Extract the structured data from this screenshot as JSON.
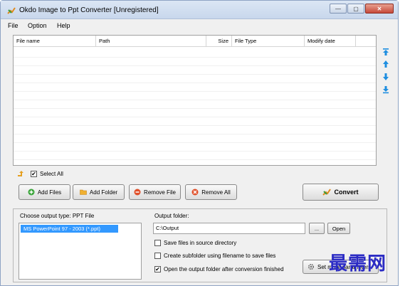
{
  "window": {
    "title": "Okdo Image to Ppt Converter [Unregistered]",
    "controls": {
      "minimize": "—",
      "maximize": "▢",
      "close": "✕"
    }
  },
  "menu": {
    "items": [
      "File",
      "Option",
      "Help"
    ]
  },
  "file_list": {
    "columns": [
      "File name",
      "Path",
      "Size",
      "File Type",
      "Modify date"
    ],
    "rows": []
  },
  "side_arrows": [
    "move-top-icon",
    "move-up-icon",
    "move-down-icon",
    "move-bottom-icon"
  ],
  "select_all": {
    "label": "Select All",
    "checked": true
  },
  "actions": {
    "add_files": "Add Files",
    "add_folder": "Add Folder",
    "remove_file": "Remove File",
    "remove_all": "Remove All",
    "convert": "Convert"
  },
  "output": {
    "type_label": "Choose output type:  PPT File",
    "types": [
      "MS PowerPoint 97 - 2003 (*.ppt)"
    ],
    "selected_type": "MS PowerPoint 97 - 2003 (*.ppt)",
    "folder_label": "Output folder:",
    "folder_value": "C:\\Output",
    "browse_label": "...",
    "open_label": "Open",
    "options": [
      {
        "label": "Save files in source directory",
        "checked": false
      },
      {
        "label": "Create subfolder using filename to save files",
        "checked": false
      },
      {
        "label": "Open the output folder after conversion finished",
        "checked": true
      }
    ],
    "set_more_label": "Set more parameters"
  },
  "watermark": "最需网",
  "colors": {
    "selection": "#3399ff",
    "titlebar": "#c8d7ec",
    "watermark": "#2b2bc4",
    "arrow": "#1e8ee0"
  }
}
